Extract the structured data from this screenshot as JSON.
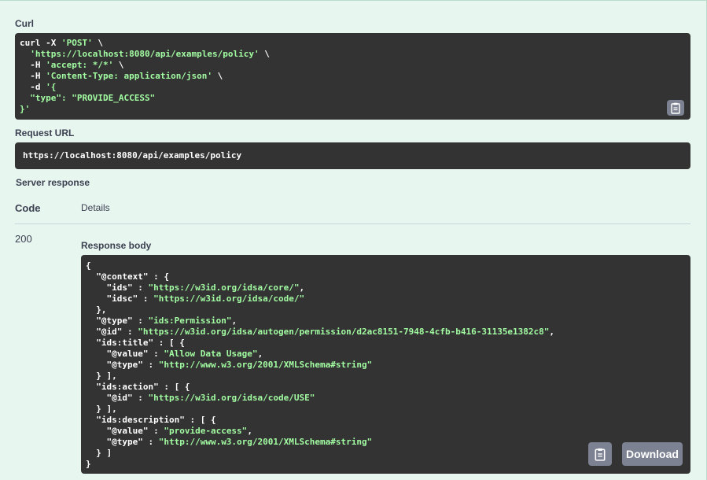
{
  "curl": {
    "label": "Curl",
    "lines": [
      [
        {
          "t": "curl -X ",
          "c": "cmd"
        },
        {
          "t": "'POST'",
          "c": "str"
        },
        {
          "t": " \\",
          "c": "cmd"
        }
      ],
      [
        {
          "t": "  ",
          "c": "cmd"
        },
        {
          "t": "'https://localhost:8080/api/examples/policy'",
          "c": "str"
        },
        {
          "t": " \\",
          "c": "cmd"
        }
      ],
      [
        {
          "t": "  -H ",
          "c": "cmd"
        },
        {
          "t": "'accept: */*'",
          "c": "str"
        },
        {
          "t": " \\",
          "c": "cmd"
        }
      ],
      [
        {
          "t": "  -H ",
          "c": "cmd"
        },
        {
          "t": "'Content-Type: application/json'",
          "c": "str"
        },
        {
          "t": " \\",
          "c": "cmd"
        }
      ],
      [
        {
          "t": "  -d ",
          "c": "cmd"
        },
        {
          "t": "'{",
          "c": "str"
        }
      ],
      [
        {
          "t": "  \"type\": \"PROVIDE_ACCESS\"",
          "c": "str"
        }
      ],
      [
        {
          "t": "}'",
          "c": "str"
        }
      ]
    ]
  },
  "request_url": {
    "label": "Request URL",
    "value": "https://localhost:8080/api/examples/policy"
  },
  "server_response": {
    "label": "Server response",
    "code_header": "Code",
    "details_header": "Details",
    "status_code": "200",
    "response_body_label": "Response body",
    "download_label": "Download"
  },
  "response_body_lines": [
    [
      {
        "t": "{",
        "c": "cmd"
      }
    ],
    [
      {
        "t": "  \"@context\" : {",
        "c": "cmd"
      }
    ],
    [
      {
        "t": "    \"ids\" : ",
        "c": "cmd"
      },
      {
        "t": "\"https://w3id.org/idsa/core/\"",
        "c": "str"
      },
      {
        "t": ",",
        "c": "cmd"
      }
    ],
    [
      {
        "t": "    \"idsc\" : ",
        "c": "cmd"
      },
      {
        "t": "\"https://w3id.org/idsa/code/\"",
        "c": "str"
      }
    ],
    [
      {
        "t": "  },",
        "c": "cmd"
      }
    ],
    [
      {
        "t": "  \"@type\" : ",
        "c": "cmd"
      },
      {
        "t": "\"ids:Permission\"",
        "c": "str"
      },
      {
        "t": ",",
        "c": "cmd"
      }
    ],
    [
      {
        "t": "  \"@id\" : ",
        "c": "cmd"
      },
      {
        "t": "\"https://w3id.org/idsa/autogen/permission/d2ac8151-7948-4cfb-b416-31135e1382c8\"",
        "c": "str"
      },
      {
        "t": ",",
        "c": "cmd"
      }
    ],
    [
      {
        "t": "  \"ids:title\" : [ {",
        "c": "cmd"
      }
    ],
    [
      {
        "t": "    \"@value\" : ",
        "c": "cmd"
      },
      {
        "t": "\"Allow Data Usage\"",
        "c": "str"
      },
      {
        "t": ",",
        "c": "cmd"
      }
    ],
    [
      {
        "t": "    \"@type\" : ",
        "c": "cmd"
      },
      {
        "t": "\"http://www.w3.org/2001/XMLSchema#string\"",
        "c": "str"
      }
    ],
    [
      {
        "t": "  } ],",
        "c": "cmd"
      }
    ],
    [
      {
        "t": "  \"ids:action\" : [ {",
        "c": "cmd"
      }
    ],
    [
      {
        "t": "    \"@id\" : ",
        "c": "cmd"
      },
      {
        "t": "\"https://w3id.org/idsa/code/USE\"",
        "c": "str"
      }
    ],
    [
      {
        "t": "  } ],",
        "c": "cmd"
      }
    ],
    [
      {
        "t": "  \"ids:description\" : [ {",
        "c": "cmd"
      }
    ],
    [
      {
        "t": "    \"@value\" : ",
        "c": "cmd"
      },
      {
        "t": "\"provide-access\"",
        "c": "str"
      },
      {
        "t": ",",
        "c": "cmd"
      }
    ],
    [
      {
        "t": "    \"@type\" : ",
        "c": "cmd"
      },
      {
        "t": "\"http://www.w3.org/2001/XMLSchema#string\"",
        "c": "str"
      }
    ],
    [
      {
        "t": "  } ]",
        "c": "cmd"
      }
    ],
    [
      {
        "t": "}",
        "c": "cmd"
      }
    ]
  ],
  "icons": {
    "copy": "clipboard-icon"
  },
  "colors": {
    "background": "#e8f6f0",
    "code_bg": "#333333",
    "string": "#a2fca2",
    "button": "#7d8293"
  }
}
